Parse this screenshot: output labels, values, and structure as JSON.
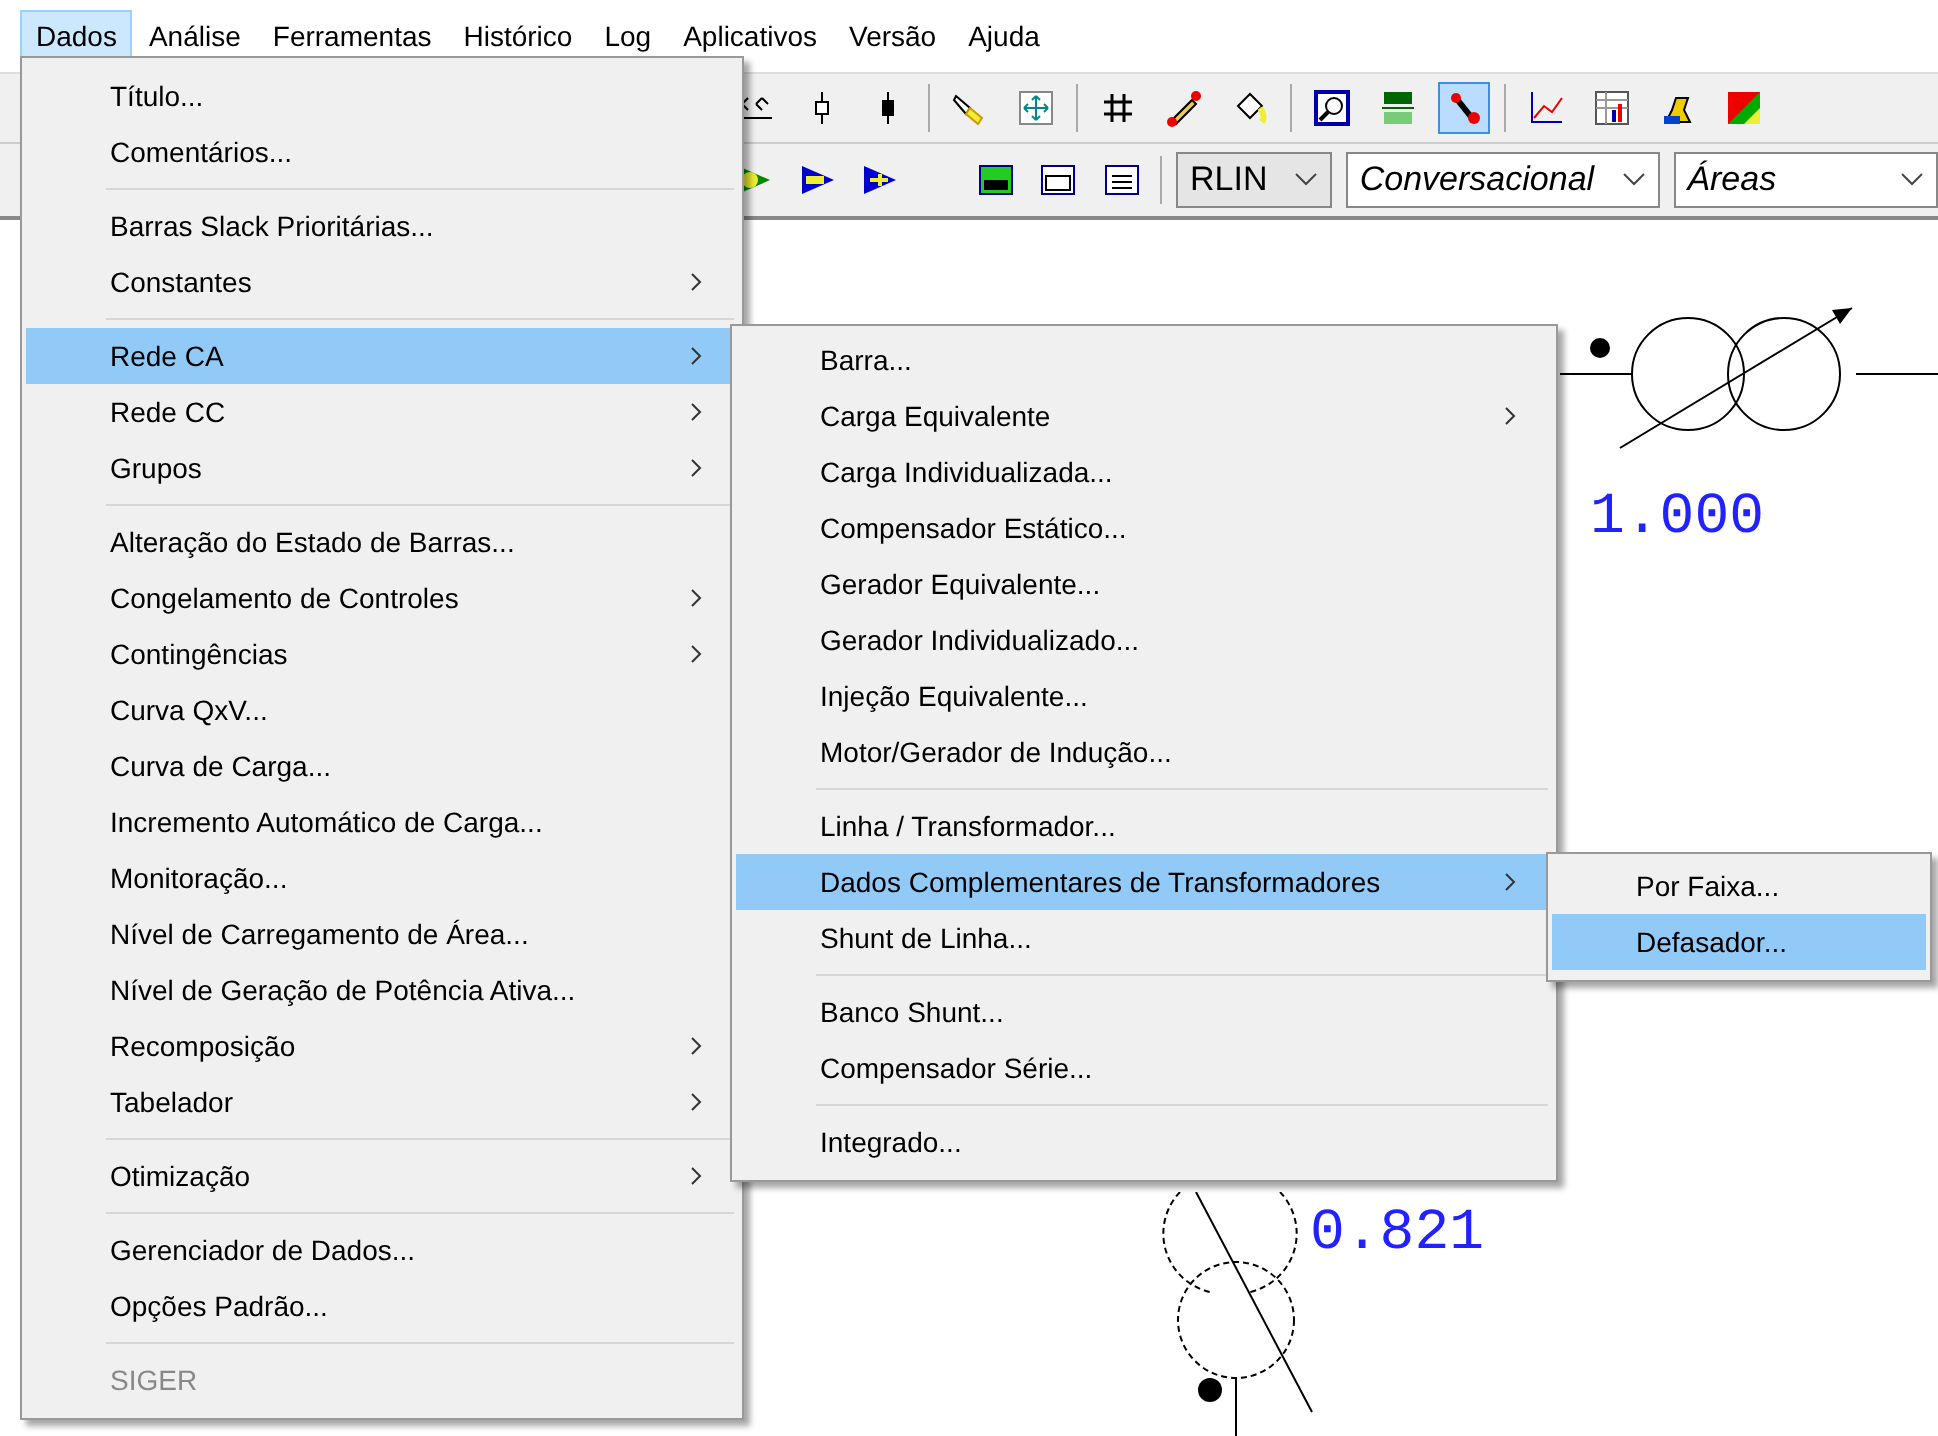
{
  "menu_bar": {
    "items": [
      {
        "label": "Dados",
        "selected": true
      },
      {
        "label": "Análise",
        "selected": false
      },
      {
        "label": "Ferramentas",
        "selected": false
      },
      {
        "label": "Histórico",
        "selected": false
      },
      {
        "label": "Log",
        "selected": false
      },
      {
        "label": "Aplicativos",
        "selected": false
      },
      {
        "label": "Versão",
        "selected": false
      },
      {
        "label": "Ajuda",
        "selected": false
      }
    ]
  },
  "toolbar_top": {
    "tools": [
      {
        "kind": "arrows",
        "selected": false
      },
      {
        "kind": "switch-open",
        "selected": false
      },
      {
        "kind": "switch-closed",
        "selected": false
      },
      {
        "kind": "separator"
      },
      {
        "kind": "flashlight",
        "selected": false
      },
      {
        "kind": "move",
        "selected": false
      },
      {
        "kind": "separator"
      },
      {
        "kind": "grid",
        "selected": false
      },
      {
        "kind": "pen",
        "selected": false
      },
      {
        "kind": "bucket",
        "selected": false
      },
      {
        "kind": "separator"
      },
      {
        "kind": "zoom",
        "selected": false
      },
      {
        "kind": "unit",
        "selected": false
      },
      {
        "kind": "pen-tool",
        "selected": true
      },
      {
        "kind": "separator"
      },
      {
        "kind": "graph",
        "selected": false
      },
      {
        "kind": "table",
        "selected": false
      },
      {
        "kind": "shape",
        "selected": false
      },
      {
        "kind": "colormap",
        "selected": false
      }
    ]
  },
  "toolbar_bottom": {
    "tools": [
      {
        "kind": "run-green",
        "selected": false
      },
      {
        "kind": "run-blue",
        "selected": false
      },
      {
        "kind": "run-blue-plus",
        "selected": false
      },
      {
        "kind": "gap"
      },
      {
        "kind": "report",
        "selected": false
      },
      {
        "kind": "dc",
        "selected": false
      },
      {
        "kind": "list",
        "selected": false
      },
      {
        "kind": "separator"
      }
    ],
    "dropdowns": [
      {
        "value": "RLIN",
        "italic": false
      },
      {
        "value": "Conversacional",
        "italic": true
      },
      {
        "value": "Áreas",
        "italic": true
      }
    ]
  },
  "diagram": {
    "labels": [
      {
        "text": "1.000",
        "kind": "top"
      },
      {
        "text": "0.821",
        "kind": "bottom"
      }
    ]
  },
  "menu": {
    "items": [
      {
        "kind": "item",
        "label": "Título...",
        "submenu": false,
        "selected": false,
        "disabled": false
      },
      {
        "kind": "item",
        "label": "Comentários...",
        "submenu": false,
        "selected": false,
        "disabled": false
      },
      {
        "kind": "separator"
      },
      {
        "kind": "item",
        "label": "Barras Slack Prioritárias...",
        "submenu": false,
        "selected": false,
        "disabled": false
      },
      {
        "kind": "item",
        "label": "Constantes",
        "submenu": true,
        "selected": false,
        "disabled": false
      },
      {
        "kind": "separator"
      },
      {
        "kind": "item",
        "label": "Rede CA",
        "submenu": true,
        "selected": true,
        "disabled": false,
        "children": [
          {
            "kind": "item",
            "label": "Barra...",
            "submenu": false,
            "selected": false,
            "disabled": false
          },
          {
            "kind": "item",
            "label": "Carga Equivalente",
            "submenu": true,
            "selected": false,
            "disabled": false
          },
          {
            "kind": "item",
            "label": "Carga Individualizada...",
            "submenu": false,
            "selected": false,
            "disabled": false
          },
          {
            "kind": "item",
            "label": "Compensador Estático...",
            "submenu": false,
            "selected": false,
            "disabled": false
          },
          {
            "kind": "item",
            "label": "Gerador Equivalente...",
            "submenu": false,
            "selected": false,
            "disabled": false
          },
          {
            "kind": "item",
            "label": "Gerador Individualizado...",
            "submenu": false,
            "selected": false,
            "disabled": false
          },
          {
            "kind": "item",
            "label": "Injeção Equivalente...",
            "submenu": false,
            "selected": false,
            "disabled": false
          },
          {
            "kind": "item",
            "label": "Motor/Gerador de Indução...",
            "submenu": false,
            "selected": false,
            "disabled": false
          },
          {
            "kind": "separator"
          },
          {
            "kind": "item",
            "label": "Linha / Transformador...",
            "submenu": false,
            "selected": false,
            "disabled": false
          },
          {
            "kind": "item",
            "label": "Dados Complementares de Transformadores",
            "submenu": true,
            "selected": true,
            "disabled": false,
            "children": [
              {
                "kind": "item",
                "label": "Por Faixa...",
                "submenu": false,
                "selected": false,
                "disabled": false
              },
              {
                "kind": "item",
                "label": "Defasador...",
                "submenu": false,
                "selected": true,
                "disabled": false
              }
            ]
          },
          {
            "kind": "item",
            "label": "Shunt de Linha...",
            "submenu": false,
            "selected": false,
            "disabled": false
          },
          {
            "kind": "separator"
          },
          {
            "kind": "item",
            "label": "Banco Shunt...",
            "submenu": false,
            "selected": false,
            "disabled": false
          },
          {
            "kind": "item",
            "label": "Compensador Série...",
            "submenu": false,
            "selected": false,
            "disabled": false
          },
          {
            "kind": "separator"
          },
          {
            "kind": "item",
            "label": "Integrado...",
            "submenu": false,
            "selected": false,
            "disabled": false
          }
        ]
      },
      {
        "kind": "item",
        "label": "Rede CC",
        "submenu": true,
        "selected": false,
        "disabled": false
      },
      {
        "kind": "item",
        "label": "Grupos",
        "submenu": true,
        "selected": false,
        "disabled": false
      },
      {
        "kind": "separator"
      },
      {
        "kind": "item",
        "label": "Alteração do Estado de Barras...",
        "submenu": false,
        "selected": false,
        "disabled": false
      },
      {
        "kind": "item",
        "label": "Congelamento de Controles",
        "submenu": true,
        "selected": false,
        "disabled": false
      },
      {
        "kind": "item",
        "label": "Contingências",
        "submenu": true,
        "selected": false,
        "disabled": false
      },
      {
        "kind": "item",
        "label": "Curva QxV...",
        "submenu": false,
        "selected": false,
        "disabled": false
      },
      {
        "kind": "item",
        "label": "Curva de Carga...",
        "submenu": false,
        "selected": false,
        "disabled": false
      },
      {
        "kind": "item",
        "label": "Incremento Automático de Carga...",
        "submenu": false,
        "selected": false,
        "disabled": false
      },
      {
        "kind": "item",
        "label": "Monitoração...",
        "submenu": false,
        "selected": false,
        "disabled": false
      },
      {
        "kind": "item",
        "label": "Nível de Carregamento de Área...",
        "submenu": false,
        "selected": false,
        "disabled": false
      },
      {
        "kind": "item",
        "label": "Nível de Geração de Potência Ativa...",
        "submenu": false,
        "selected": false,
        "disabled": false
      },
      {
        "kind": "item",
        "label": "Recomposição",
        "submenu": true,
        "selected": false,
        "disabled": false
      },
      {
        "kind": "item",
        "label": "Tabelador",
        "submenu": true,
        "selected": false,
        "disabled": false
      },
      {
        "kind": "separator"
      },
      {
        "kind": "item",
        "label": "Otimização",
        "submenu": true,
        "selected": false,
        "disabled": false
      },
      {
        "kind": "separator"
      },
      {
        "kind": "item",
        "label": "Gerenciador de Dados...",
        "submenu": false,
        "selected": false,
        "disabled": false
      },
      {
        "kind": "item",
        "label": "Opções Padrão...",
        "submenu": false,
        "selected": false,
        "disabled": false
      },
      {
        "kind": "separator"
      },
      {
        "kind": "item",
        "label": "SIGER",
        "submenu": false,
        "selected": false,
        "disabled": true
      }
    ]
  }
}
